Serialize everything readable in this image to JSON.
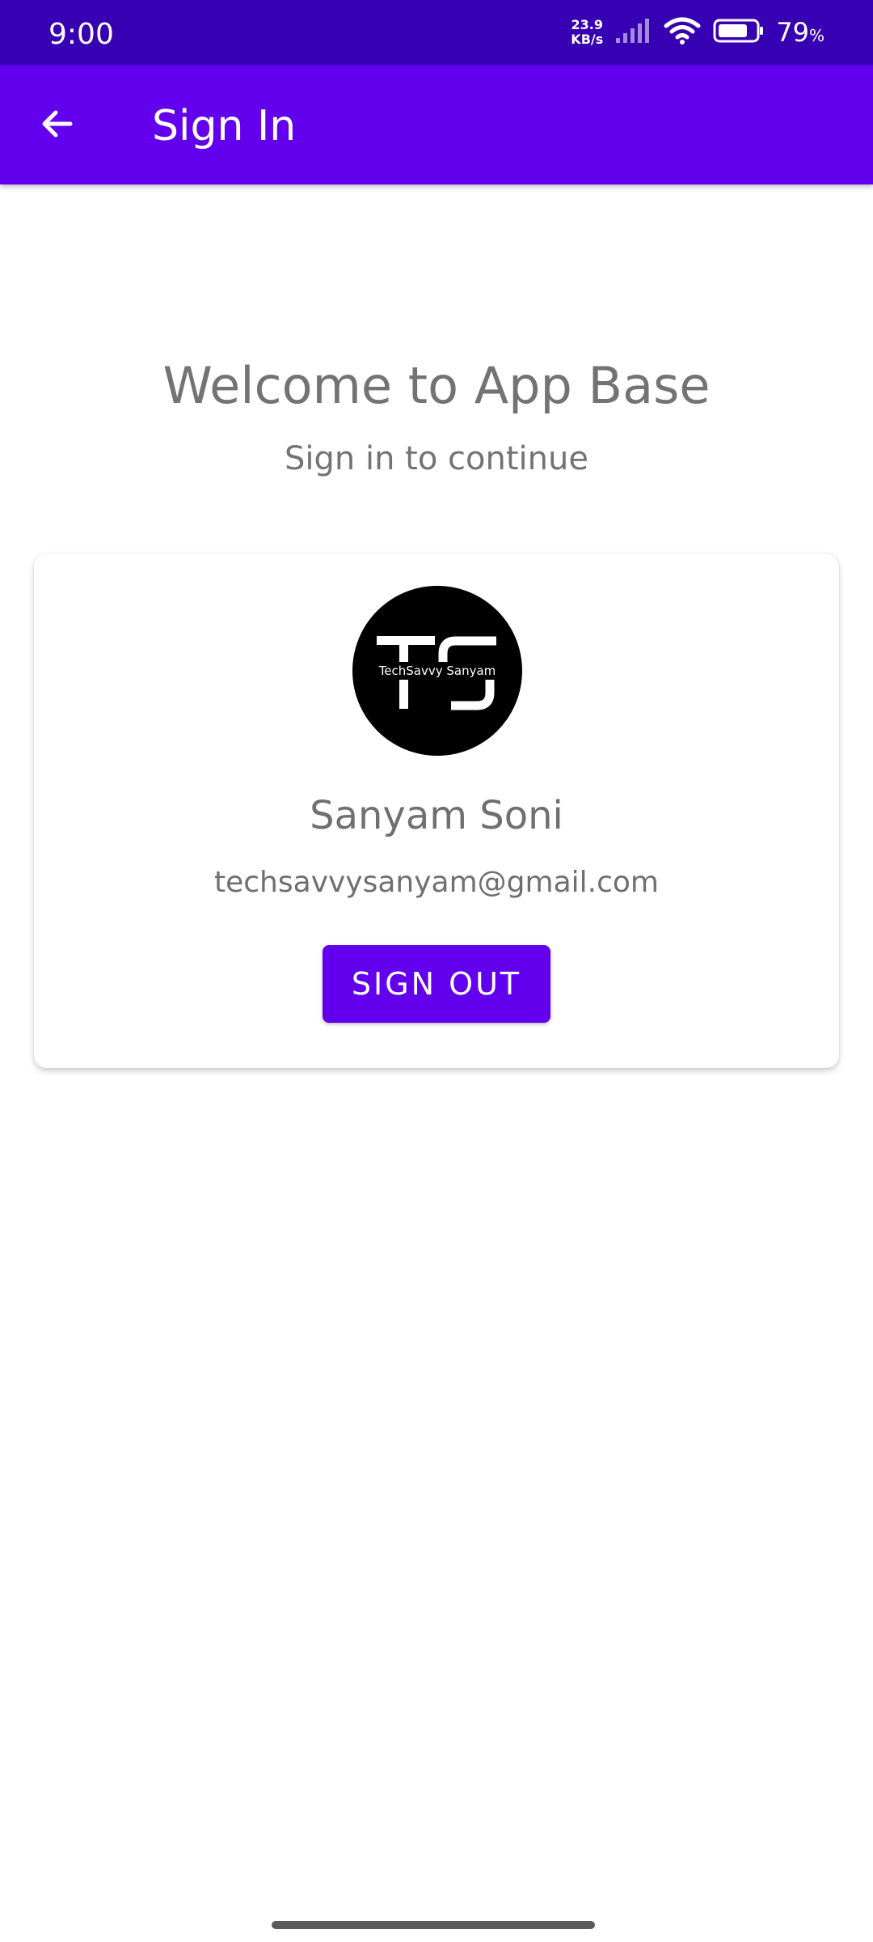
{
  "status_bar": {
    "time": "9:00",
    "net_speed_value": "23.9",
    "net_speed_unit": "KB/s",
    "battery_percent": "79",
    "battery_percent_sign": "%",
    "battery_level": 0.79,
    "icons": [
      "signal-icon",
      "wifi-icon",
      "battery-icon"
    ]
  },
  "app_bar": {
    "title": "Sign In",
    "back_icon": "arrow-back-icon"
  },
  "main": {
    "welcome_title": "Welcome to App Base",
    "welcome_subtitle": "Sign in to continue"
  },
  "profile": {
    "avatar_text": "TechSavvy Sanyam",
    "avatar_initials": "TS",
    "name": "Sanyam Soni",
    "email": "techsavvysanyam@gmail.com",
    "sign_out_label": "SIGN OUT"
  },
  "colors": {
    "status_bar": "#3700B3",
    "primary": "#6200EE",
    "text_secondary": "#737373"
  }
}
